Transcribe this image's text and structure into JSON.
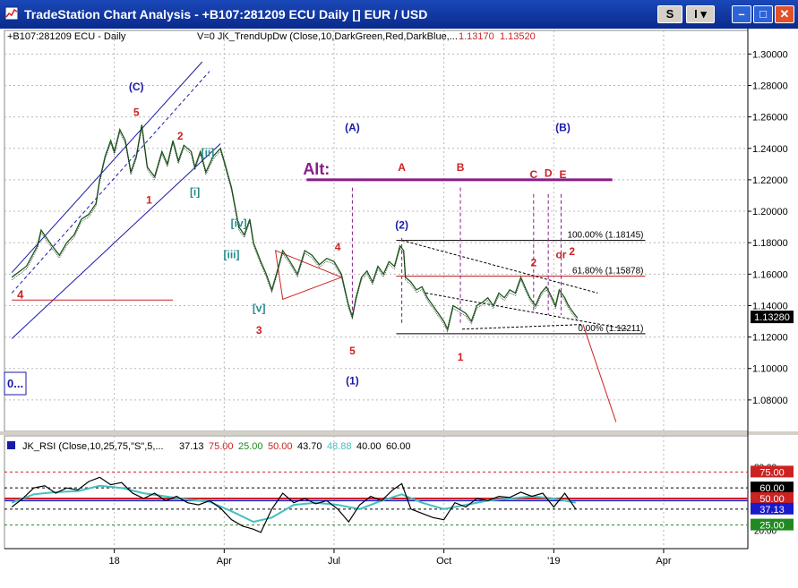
{
  "window": {
    "title": "TradeStation Chart Analysis  - +B107:281209 ECU Daily [] EUR / USD",
    "btn_s": "S",
    "btn_i": "I",
    "min_glyph": "–",
    "max_glyph": "□",
    "close_glyph": "✕",
    "accent": "#0a2a8c"
  },
  "chart_data": [
    {
      "type": "line",
      "symbol": "+B107:281209 ECU - Daily",
      "indicator_label": "V=0  JK_TrendUpDw (Close,10,DarkGreen,Red,DarkBlue,...",
      "indicator_values": [
        "1.13170",
        "1.13520"
      ],
      "ylim": [
        1.06,
        1.315
      ],
      "yticks": [
        1.08,
        1.1,
        1.12,
        1.14,
        1.16,
        1.18,
        1.2,
        1.22,
        1.24,
        1.26,
        1.28,
        1.3
      ],
      "ytick_labels": [
        "1.08000",
        "1.10000",
        "1.12000",
        "1.14000",
        "1.16000",
        "1.18000",
        "1.20000",
        "1.22000",
        "1.24000",
        "1.26000",
        "1.28000",
        "1.30000"
      ],
      "last_price_label": "1.13280",
      "last_price": 1.1328,
      "x_months": [
        {
          "label": "18",
          "m": 3
        },
        {
          "label": "Apr",
          "m": 6
        },
        {
          "label": "Jul",
          "m": 9
        },
        {
          "label": "Oct",
          "m": 12
        },
        {
          "label": "'19",
          "m": 15
        },
        {
          "label": "Apr",
          "m": 18
        }
      ],
      "xlim_months": [
        0,
        20.3
      ],
      "price_path": [
        [
          0.2,
          1.158
        ],
        [
          0.6,
          1.165
        ],
        [
          0.9,
          1.178
        ],
        [
          1.0,
          1.188
        ],
        [
          1.15,
          1.183
        ],
        [
          1.3,
          1.178
        ],
        [
          1.5,
          1.172
        ],
        [
          1.7,
          1.18
        ],
        [
          1.9,
          1.185
        ],
        [
          2.1,
          1.195
        ],
        [
          2.3,
          1.198
        ],
        [
          2.5,
          1.205
        ],
        [
          2.6,
          1.22
        ],
        [
          2.75,
          1.235
        ],
        [
          2.9,
          1.245
        ],
        [
          3.0,
          1.238
        ],
        [
          3.15,
          1.252
        ],
        [
          3.3,
          1.245
        ],
        [
          3.45,
          1.225
        ],
        [
          3.6,
          1.235
        ],
        [
          3.75,
          1.255
        ],
        [
          3.9,
          1.228
        ],
        [
          4.1,
          1.222
        ],
        [
          4.3,
          1.238
        ],
        [
          4.45,
          1.23
        ],
        [
          4.6,
          1.245
        ],
        [
          4.75,
          1.232
        ],
        [
          4.9,
          1.242
        ],
        [
          5.1,
          1.238
        ],
        [
          5.2,
          1.228
        ],
        [
          5.35,
          1.238
        ],
        [
          5.5,
          1.225
        ],
        [
          5.7,
          1.235
        ],
        [
          5.9,
          1.24
        ],
        [
          6.0,
          1.232
        ],
        [
          6.2,
          1.215
        ],
        [
          6.4,
          1.19
        ],
        [
          6.55,
          1.185
        ],
        [
          6.7,
          1.195
        ],
        [
          6.8,
          1.18
        ],
        [
          7.0,
          1.168
        ],
        [
          7.15,
          1.16
        ],
        [
          7.3,
          1.15
        ],
        [
          7.45,
          1.162
        ],
        [
          7.6,
          1.175
        ],
        [
          7.8,
          1.168
        ],
        [
          8.0,
          1.16
        ],
        [
          8.2,
          1.175
        ],
        [
          8.4,
          1.172
        ],
        [
          8.6,
          1.166
        ],
        [
          8.8,
          1.17
        ],
        [
          9.0,
          1.168
        ],
        [
          9.2,
          1.16
        ],
        [
          9.3,
          1.15
        ],
        [
          9.4,
          1.14
        ],
        [
          9.5,
          1.133
        ],
        [
          9.6,
          1.145
        ],
        [
          9.75,
          1.158
        ],
        [
          9.9,
          1.162
        ],
        [
          10.05,
          1.155
        ],
        [
          10.2,
          1.165
        ],
        [
          10.35,
          1.16
        ],
        [
          10.5,
          1.168
        ],
        [
          10.65,
          1.165
        ],
        [
          10.8,
          1.178
        ],
        [
          10.9,
          1.175
        ],
        [
          10.95,
          1.158
        ],
        [
          11.1,
          1.155
        ],
        [
          11.25,
          1.15
        ],
        [
          11.4,
          1.152
        ],
        [
          11.55,
          1.145
        ],
        [
          11.7,
          1.14
        ],
        [
          11.85,
          1.135
        ],
        [
          12.0,
          1.13
        ],
        [
          12.1,
          1.125
        ],
        [
          12.25,
          1.14
        ],
        [
          12.4,
          1.138
        ],
        [
          12.6,
          1.135
        ],
        [
          12.75,
          1.13
        ],
        [
          12.9,
          1.14
        ],
        [
          13.05,
          1.142
        ],
        [
          13.2,
          1.145
        ],
        [
          13.35,
          1.14
        ],
        [
          13.5,
          1.148
        ],
        [
          13.65,
          1.145
        ],
        [
          13.8,
          1.15
        ],
        [
          13.95,
          1.148
        ],
        [
          14.1,
          1.158
        ],
        [
          14.25,
          1.15
        ],
        [
          14.35,
          1.145
        ],
        [
          14.5,
          1.14
        ],
        [
          14.65,
          1.148
        ],
        [
          14.8,
          1.152
        ],
        [
          14.95,
          1.145
        ],
        [
          15.05,
          1.14
        ],
        [
          15.15,
          1.15
        ],
        [
          15.3,
          1.145
        ],
        [
          15.4,
          1.14
        ],
        [
          15.55,
          1.135
        ],
        [
          15.65,
          1.132
        ]
      ],
      "channel_lines": [
        {
          "name": "",
          "from": [
            0.2,
            1.161
          ],
          "to": [
            5.4,
            1.295
          ],
          "color": "#1a1aa8",
          "dash": false
        },
        {
          "name": "",
          "from": [
            0.2,
            1.148
          ],
          "to": [
            5.6,
            1.289
          ],
          "color": "#1a1aa8",
          "dash": true
        },
        {
          "name": "",
          "from": [
            0.2,
            1.119
          ],
          "to": [
            5.9,
            1.243
          ],
          "color": "#1a1aa8",
          "dash": false
        }
      ],
      "fib": {
        "levels": [
          {
            "label": "100.00% (1.18145)",
            "price": 1.18145,
            "x0": 10.7,
            "x1": 17.5,
            "color": "#000000"
          },
          {
            "label": "61.80% (1.15878)",
            "price": 1.15878,
            "x0": 10.7,
            "x1": 17.5,
            "color": "#cc2222"
          },
          {
            "label": "0.00% (1.12211)",
            "price": 1.12211,
            "x0": 10.7,
            "x1": 17.5,
            "color": "#000000"
          }
        ]
      },
      "alt_line": {
        "label": "Alt:",
        "price": 1.22,
        "x0": 8.25,
        "x1": 16.6,
        "color": "#881c88"
      },
      "red_hline": {
        "label": "4",
        "price": 1.1435,
        "x0": 0.2,
        "x1": 4.6
      },
      "triangle_1": [
        [
          7.4,
          1.175
        ],
        [
          9.2,
          1.158
        ],
        [
          7.6,
          1.144
        ]
      ],
      "breakdown_line": {
        "from": [
          15.8,
          1.128
        ],
        "to": [
          16.7,
          1.066
        ]
      },
      "vlines": [
        {
          "m": 9.5,
          "p0": 1.215,
          "p1": 1.132
        },
        {
          "m": 10.85,
          "p0": 1.183,
          "p1": 1.128
        },
        {
          "m": 12.45,
          "p0": 1.215,
          "p1": 1.129
        },
        {
          "m": 14.45,
          "p0": 1.211,
          "p1": 1.136
        },
        {
          "m": 14.85,
          "p0": 1.211,
          "p1": 1.134
        },
        {
          "m": 15.2,
          "p0": 1.211,
          "p1": 1.134
        }
      ],
      "wave_labels": [
        {
          "text": "(C)",
          "m": 3.6,
          "p": 1.277,
          "color": "#1a1aa8"
        },
        {
          "text": "5",
          "m": 3.6,
          "p": 1.2605,
          "color": "#cc2222"
        },
        {
          "text": "2",
          "m": 4.8,
          "p": 1.2455,
          "color": "#cc2222"
        },
        {
          "text": "1",
          "m": 3.95,
          "p": 1.205,
          "color": "#cc2222"
        },
        {
          "text": "[ii]",
          "m": 5.55,
          "p": 1.235,
          "color": "#2a8a8a"
        },
        {
          "text": "[i]",
          "m": 5.2,
          "p": 1.21,
          "color": "#2a8a8a"
        },
        {
          "text": "[iv]",
          "m": 6.4,
          "p": 1.19,
          "color": "#2a8a8a"
        },
        {
          "text": "[iii]",
          "m": 6.2,
          "p": 1.17,
          "color": "#2a8a8a"
        },
        {
          "text": "[v]",
          "m": 6.95,
          "p": 1.136,
          "color": "#2a8a8a"
        },
        {
          "text": "3",
          "m": 6.95,
          "p": 1.122,
          "color": "#cc2222"
        },
        {
          "text": "4",
          "m": 9.1,
          "p": 1.175,
          "color": "#cc2222"
        },
        {
          "text": "5",
          "m": 9.5,
          "p": 1.109,
          "color": "#cc2222"
        },
        {
          "text": "(1)",
          "m": 9.5,
          "p": 1.09,
          "color": "#1a1aa8"
        },
        {
          "text": "(A)",
          "m": 9.5,
          "p": 1.251,
          "color": "#1a1aa8"
        },
        {
          "text": "(2)",
          "m": 10.85,
          "p": 1.189,
          "color": "#1a1aa8"
        },
        {
          "text": "A",
          "m": 10.85,
          "p": 1.2255,
          "color": "#cc2222"
        },
        {
          "text": "B",
          "m": 12.45,
          "p": 1.2255,
          "color": "#cc2222"
        },
        {
          "text": "1",
          "m": 12.45,
          "p": 1.105,
          "color": "#cc2222"
        },
        {
          "text": "C",
          "m": 14.45,
          "p": 1.221,
          "color": "#cc2222"
        },
        {
          "text": "D",
          "m": 14.85,
          "p": 1.222,
          "color": "#cc2222"
        },
        {
          "text": "E",
          "m": 15.25,
          "p": 1.221,
          "color": "#cc2222"
        },
        {
          "text": "(B)",
          "m": 15.25,
          "p": 1.251,
          "color": "#1a1aa8"
        },
        {
          "text": "2",
          "m": 14.45,
          "p": 1.165,
          "color": "#cc2222"
        },
        {
          "text": "or",
          "m": 15.2,
          "p": 1.17,
          "color": "#cc2222"
        },
        {
          "text": "2",
          "m": 15.5,
          "p": 1.172,
          "color": "#cc2222"
        }
      ],
      "partial_label": "0..."
    },
    {
      "type": "line",
      "indicator_label": "JK_RSI (Close,10,25,75,\"S\",5,...",
      "readout": [
        {
          "text": "37.13",
          "color": "#000000"
        },
        {
          "text": "75.00",
          "color": "#cc2222"
        },
        {
          "text": "25.00",
          "color": "#228822"
        },
        {
          "text": "50.00",
          "color": "#cc2222"
        },
        {
          "text": "43.70",
          "color": "#000000"
        },
        {
          "text": "48.88",
          "color": "#44c0c0"
        },
        {
          "text": "40.00",
          "color": "#000000"
        },
        {
          "text": "60.00",
          "color": "#000000"
        }
      ],
      "ylim": [
        12,
        88
      ],
      "ytick_labels": [
        {
          "text": "80.00",
          "v": 80
        },
        {
          "text": "20.00",
          "v": 20
        }
      ],
      "value_tags": [
        {
          "text": "75.00",
          "v": 75,
          "bg": "#cc2222",
          "fg": "#ffffff"
        },
        {
          "text": "60.00",
          "v": 60,
          "bg": "#000000",
          "fg": "#ffffff"
        },
        {
          "text": "50.00",
          "v": 50,
          "bg": "#cc2222",
          "fg": "#ffffff"
        },
        {
          "text": "37.13",
          "v": 40,
          "bg": "#1a1acc",
          "fg": "#ffffff"
        },
        {
          "text": "25.00",
          "v": 25,
          "bg": "#228822",
          "fg": "#ffffff"
        }
      ],
      "hlines": [
        {
          "v": 75,
          "color": "#cc2222",
          "dash": true
        },
        {
          "v": 60,
          "color": "#000000",
          "dash": true
        },
        {
          "v": 50,
          "color": "#cc2222",
          "dash": false,
          "width": 2
        },
        {
          "v": 48,
          "color": "#1a1acc",
          "dash": false,
          "width": 1.4
        },
        {
          "v": 40,
          "color": "#000000",
          "dash": true
        },
        {
          "v": 25,
          "color": "#228822",
          "dash": true
        }
      ],
      "rsi_path": [
        [
          0.2,
          42
        ],
        [
          0.5,
          50
        ],
        [
          0.8,
          60
        ],
        [
          1.1,
          62
        ],
        [
          1.4,
          55
        ],
        [
          1.7,
          60
        ],
        [
          2.0,
          58
        ],
        [
          2.3,
          66
        ],
        [
          2.6,
          70
        ],
        [
          2.9,
          63
        ],
        [
          3.2,
          65
        ],
        [
          3.5,
          55
        ],
        [
          3.8,
          50
        ],
        [
          4.1,
          55
        ],
        [
          4.4,
          48
        ],
        [
          4.7,
          52
        ],
        [
          5.0,
          46
        ],
        [
          5.3,
          44
        ],
        [
          5.6,
          48
        ],
        [
          5.9,
          41
        ],
        [
          6.2,
          30
        ],
        [
          6.5,
          24
        ],
        [
          6.8,
          21
        ],
        [
          7.0,
          18
        ],
        [
          7.3,
          40
        ],
        [
          7.6,
          55
        ],
        [
          7.9,
          46
        ],
        [
          8.2,
          50
        ],
        [
          8.5,
          45
        ],
        [
          8.8,
          48
        ],
        [
          9.1,
          40
        ],
        [
          9.4,
          28
        ],
        [
          9.7,
          44
        ],
        [
          10.0,
          52
        ],
        [
          10.3,
          48
        ],
        [
          10.6,
          58
        ],
        [
          10.85,
          64
        ],
        [
          11.1,
          40
        ],
        [
          11.4,
          36
        ],
        [
          11.7,
          32
        ],
        [
          12.0,
          30
        ],
        [
          12.3,
          46
        ],
        [
          12.6,
          42
        ],
        [
          12.9,
          50
        ],
        [
          13.2,
          48
        ],
        [
          13.5,
          52
        ],
        [
          13.8,
          51
        ],
        [
          14.1,
          56
        ],
        [
          14.4,
          52
        ],
        [
          14.7,
          55
        ],
        [
          15.0,
          42
        ],
        [
          15.3,
          55
        ],
        [
          15.6,
          40
        ]
      ],
      "signal_path": [
        [
          0.2,
          46
        ],
        [
          0.8,
          54
        ],
        [
          1.4,
          56
        ],
        [
          2.0,
          57
        ],
        [
          2.6,
          62
        ],
        [
          3.2,
          60
        ],
        [
          3.8,
          55
        ],
        [
          4.4,
          52
        ],
        [
          5.0,
          49
        ],
        [
          5.6,
          47
        ],
        [
          6.2,
          38
        ],
        [
          6.8,
          28
        ],
        [
          7.3,
          32
        ],
        [
          7.9,
          44
        ],
        [
          8.5,
          46
        ],
        [
          9.1,
          44
        ],
        [
          9.7,
          40
        ],
        [
          10.3,
          48
        ],
        [
          10.85,
          54
        ],
        [
          11.4,
          46
        ],
        [
          12.0,
          40
        ],
        [
          12.6,
          44
        ],
        [
          13.2,
          48
        ],
        [
          13.8,
          50
        ],
        [
          14.4,
          52
        ],
        [
          15.0,
          50
        ],
        [
          15.6,
          46
        ]
      ]
    }
  ]
}
